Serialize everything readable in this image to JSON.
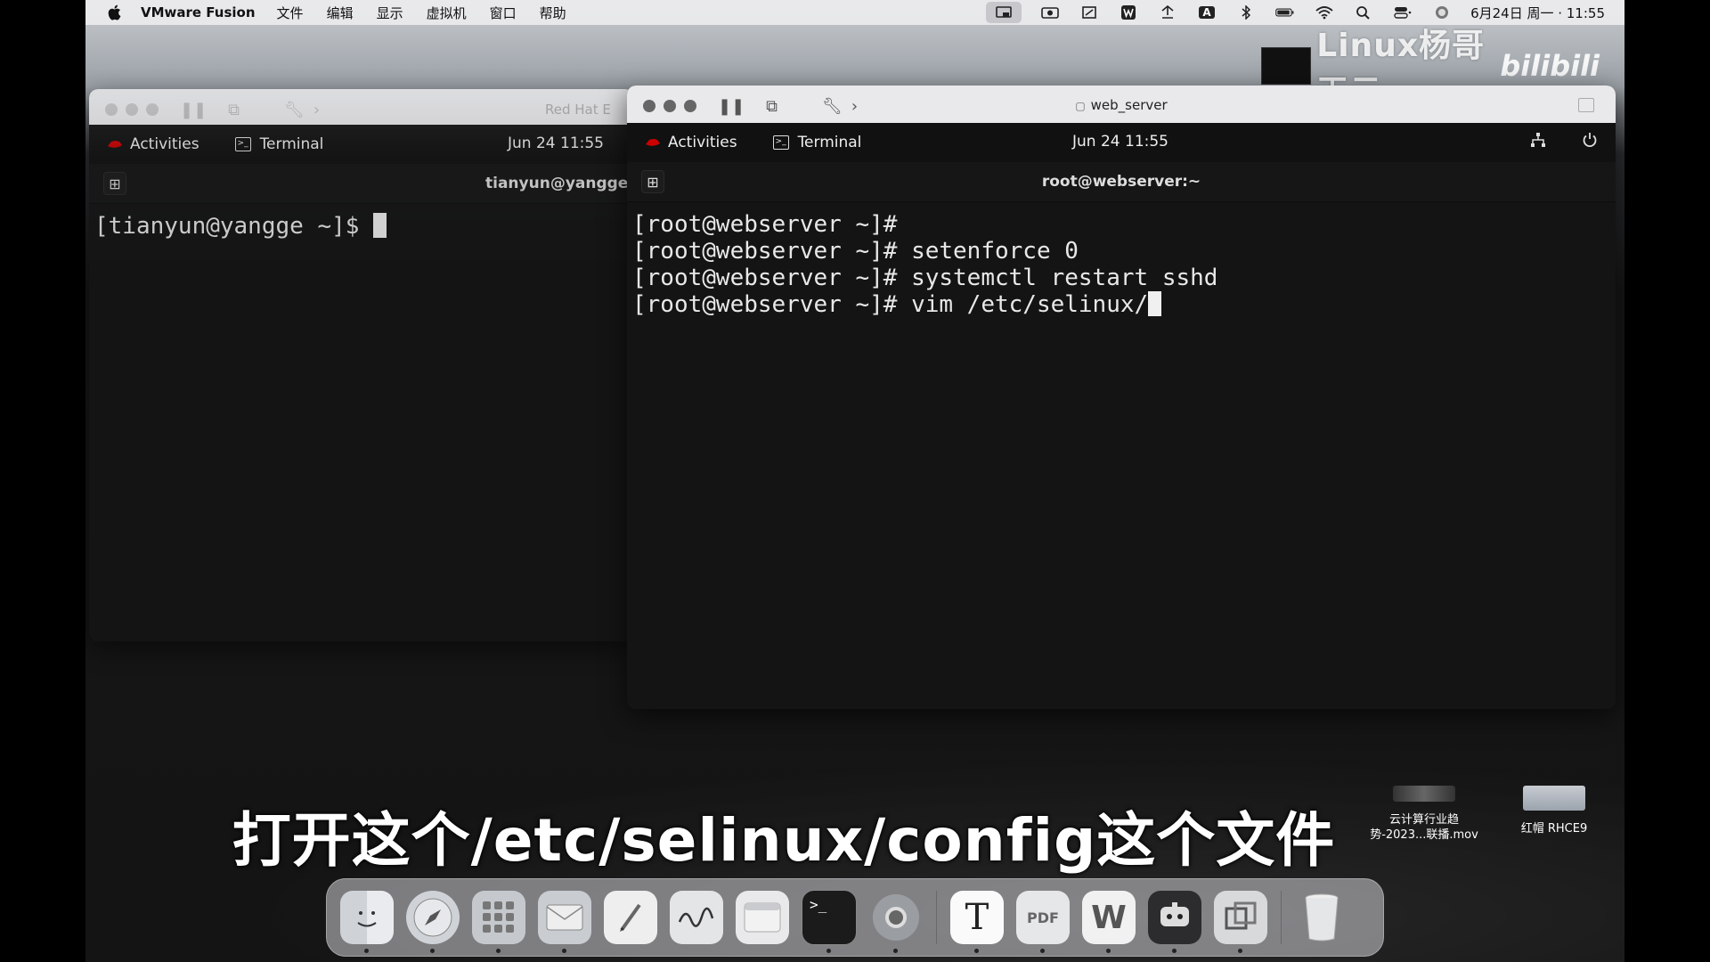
{
  "menubar": {
    "app_name": "VMware Fusion",
    "menus": [
      "文件",
      "编辑",
      "显示",
      "虚拟机",
      "窗口",
      "帮助"
    ],
    "status_icons": [
      "screen-mirror-icon",
      "camera-icon",
      "screenshot-icon",
      "wps-icon",
      "sync-icon",
      "input-method-icon",
      "bluetooth-icon",
      "battery-icon",
      "wifi-icon",
      "spotlight-icon",
      "control-center-icon",
      "siri-icon"
    ],
    "input_method_label": "A",
    "clock": "6月24日 周一 · 11:55"
  },
  "watermark": {
    "text": "Linux杨哥天云",
    "logo": "bilibili"
  },
  "left_vm": {
    "title": "Red Hat E",
    "gnome": {
      "activities": "Activities",
      "app": "Terminal",
      "date": "Jun 24  11:55"
    },
    "terminal": {
      "title": "tianyun@yangge:~",
      "lines": [
        "[tianyun@yangge ~]$ "
      ]
    }
  },
  "right_vm": {
    "title": "web_server",
    "gnome": {
      "activities": "Activities",
      "app": "Terminal",
      "date": "Jun 24  11:55"
    },
    "terminal": {
      "title": "root@webserver:~",
      "lines": [
        "[root@webserver ~]#",
        "[root@webserver ~]# setenforce 0",
        "[root@webserver ~]# systemctl restart sshd",
        "[root@webserver ~]# vim /etc/selinux/"
      ]
    }
  },
  "subtitle": "打开这个/etc/selinux/config这个文件",
  "desktop_icons": [
    {
      "label_line1": "云计算行业趋",
      "label_line2": "势-2023...联播.mov"
    },
    {
      "label_line1": "红帽 RHCE9",
      "label_line2": ""
    }
  ],
  "dock": {
    "items": [
      "finder",
      "safari",
      "launchpad",
      "mail",
      "notes-pen",
      "freeform",
      "window",
      "terminal",
      "chrome",
      "typora",
      "pdf-expert",
      "wps",
      "chatbot",
      "vmware",
      "trash"
    ],
    "typora_glyph": "T",
    "pdf_glyph": "PDF",
    "wps_glyph": "W",
    "terminal_glyph": ">_"
  }
}
